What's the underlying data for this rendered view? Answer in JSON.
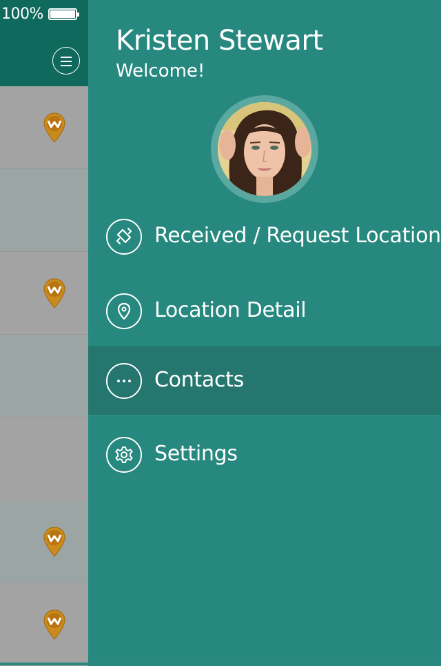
{
  "status_bar": {
    "battery_percent": "100%",
    "battery_level": 1.0
  },
  "user": {
    "name": "Kristen Stewart",
    "greeting": "Welcome!"
  },
  "menu": {
    "items": [
      {
        "label": "Received / Request Location",
        "icon": "location-exchange-icon",
        "active": false
      },
      {
        "label": "Location Detail",
        "icon": "map-pin-icon",
        "active": false
      },
      {
        "label": "Contacts",
        "icon": "more-dots-icon",
        "active": true
      },
      {
        "label": "Settings",
        "icon": "gear-icon",
        "active": false
      }
    ]
  },
  "colors": {
    "drawer_bg": "#26887e",
    "active_item_bg": "#24766e",
    "header_bg": "#10695d",
    "pin_orange": "#c98a1e"
  }
}
